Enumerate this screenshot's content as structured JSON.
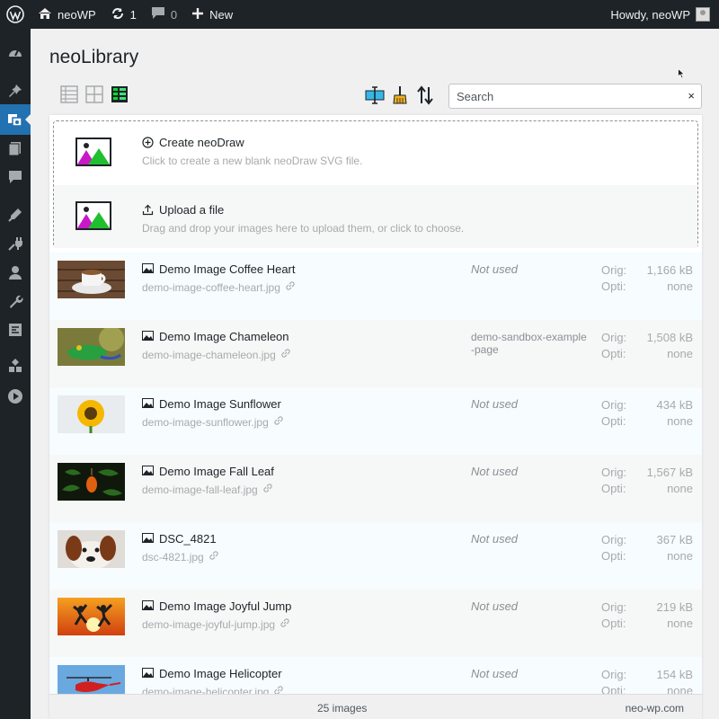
{
  "adminbar": {
    "site_name": "neoWP",
    "updates_count": "1",
    "comments_count": "0",
    "new_label": "New",
    "howdy": "Howdy, neoWP"
  },
  "sidebar": {
    "items": [
      {
        "name": "dashboard-icon"
      },
      {
        "name": "pin-icon"
      },
      {
        "name": "media-icon",
        "active": true
      },
      {
        "name": "pages-icon"
      },
      {
        "name": "comments-icon"
      },
      {
        "name": "appearance-icon"
      },
      {
        "name": "plugins-icon"
      },
      {
        "name": "users-icon"
      },
      {
        "name": "tools-icon"
      },
      {
        "name": "settings-icon"
      },
      {
        "name": "blocks-icon"
      },
      {
        "name": "play-icon"
      }
    ]
  },
  "page": {
    "title": "neoLibrary"
  },
  "search": {
    "placeholder": "Search",
    "clear": "×"
  },
  "dropzone": {
    "create_title": "Create neoDraw",
    "create_sub": "Click to create a new blank neoDraw SVG file.",
    "upload_title": "Upload a file",
    "upload_sub": "Drag and drop your images here to upload them, or click to choose."
  },
  "size_labels": {
    "orig": "Orig:",
    "opti": "Opti:"
  },
  "images": [
    {
      "title": "Demo Image Coffee Heart",
      "file": "demo-image-coffee-heart.jpg",
      "usage": "Not used",
      "orig": "1,166 kB",
      "opti": "none",
      "thumb": "coffee"
    },
    {
      "title": "Demo Image Chameleon",
      "file": "demo-image-chameleon.jpg",
      "usage": "demo-sandbox-example-page",
      "orig": "1,508 kB",
      "opti": "none",
      "thumb": "chameleon"
    },
    {
      "title": "Demo Image Sunflower",
      "file": "demo-image-sunflower.jpg",
      "usage": "Not used",
      "orig": "434 kB",
      "opti": "none",
      "thumb": "sunflower"
    },
    {
      "title": "Demo Image Fall Leaf",
      "file": "demo-image-fall-leaf.jpg",
      "usage": "Not used",
      "orig": "1,567 kB",
      "opti": "none",
      "thumb": "leaf"
    },
    {
      "title": "DSC_4821",
      "file": "dsc-4821.jpg",
      "usage": "Not used",
      "orig": "367 kB",
      "opti": "none",
      "thumb": "dog"
    },
    {
      "title": "Demo Image Joyful Jump",
      "file": "demo-image-joyful-jump.jpg",
      "usage": "Not used",
      "orig": "219 kB",
      "opti": "none",
      "thumb": "jump"
    },
    {
      "title": "Demo Image Helicopter",
      "file": "demo-image-helicopter.jpg",
      "usage": "Not used",
      "orig": "154 kB",
      "opti": "none",
      "thumb": "heli"
    }
  ],
  "footer": {
    "count": "25 images",
    "brand": "neo-wp.com"
  },
  "colors": {
    "adminbar": "#1d2327",
    "accent": "#2271b1",
    "text_muted": "#a7aaad"
  }
}
